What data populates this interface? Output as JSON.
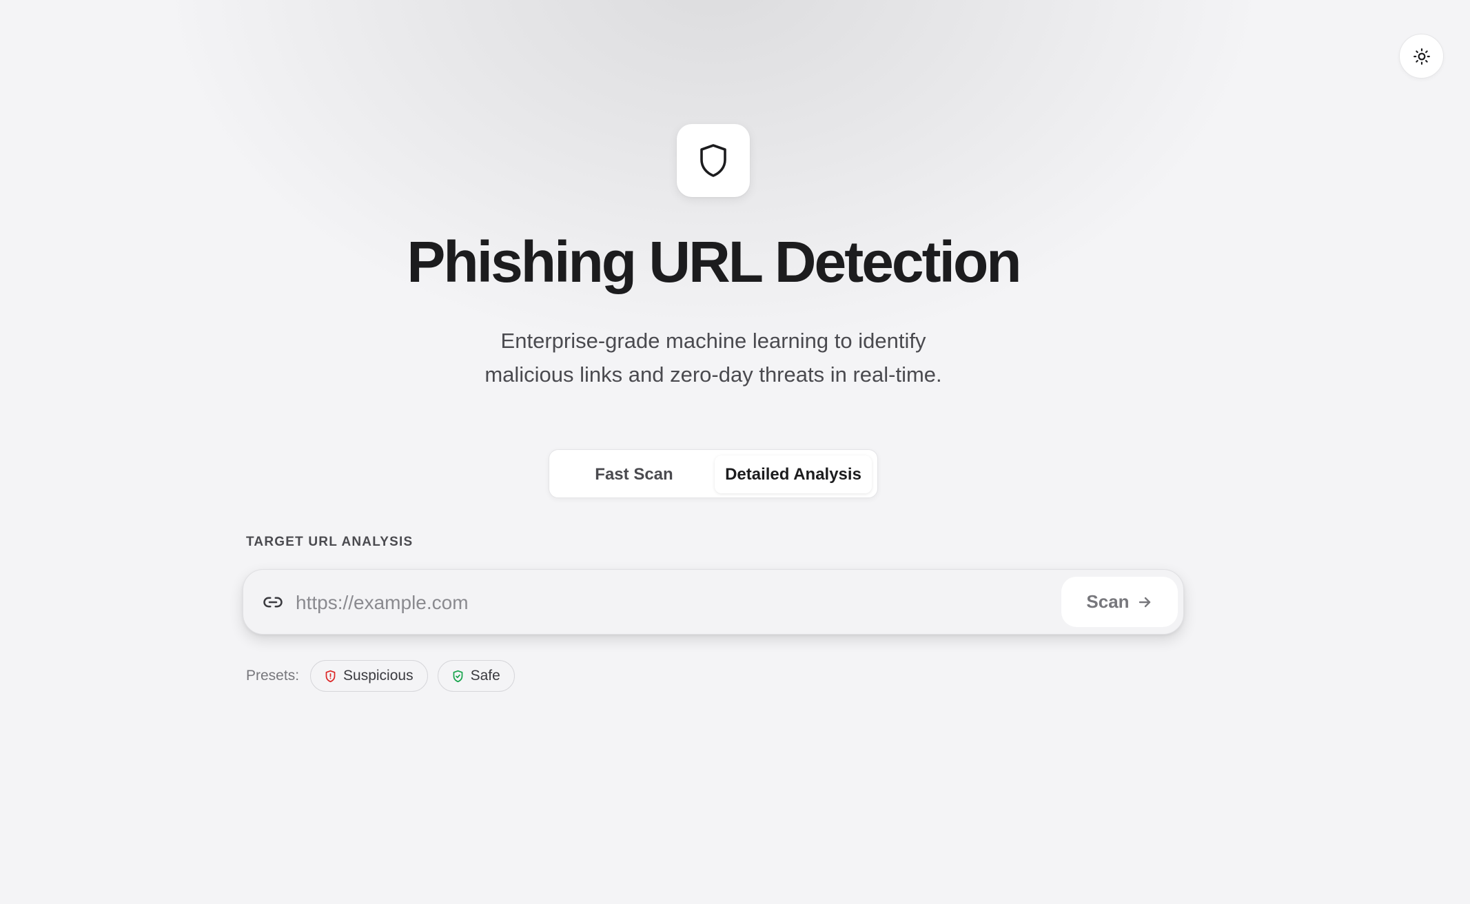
{
  "header": {
    "title": "Phishing URL Detection",
    "subtitle_line1": "Enterprise-grade machine learning to identify",
    "subtitle_line2": "malicious links and zero-day threats in real-time."
  },
  "icons": {
    "theme_toggle": "sun-icon",
    "logo": "shield-icon",
    "url_field": "link-icon",
    "scan": "arrow-right-icon",
    "preset_suspicious": "shield-alert-icon",
    "preset_safe": "shield-check-icon"
  },
  "mode": {
    "tabs": [
      {
        "label": "Fast Scan",
        "selected": false
      },
      {
        "label": "Detailed Analysis",
        "selected": true
      }
    ]
  },
  "analysis": {
    "section_label": "TARGET URL ANALYSIS",
    "url_value": "",
    "url_placeholder": "https://example.com",
    "scan_label": "Scan"
  },
  "presets": {
    "label": "Presets:",
    "items": [
      {
        "label": "Suspicious",
        "color": "#dc2626"
      },
      {
        "label": "Safe",
        "color": "#16a34a"
      }
    ]
  },
  "colors": {
    "background": "#f4f4f6",
    "title": "#1c1c1e",
    "muted_text": "#4a4a4f"
  }
}
